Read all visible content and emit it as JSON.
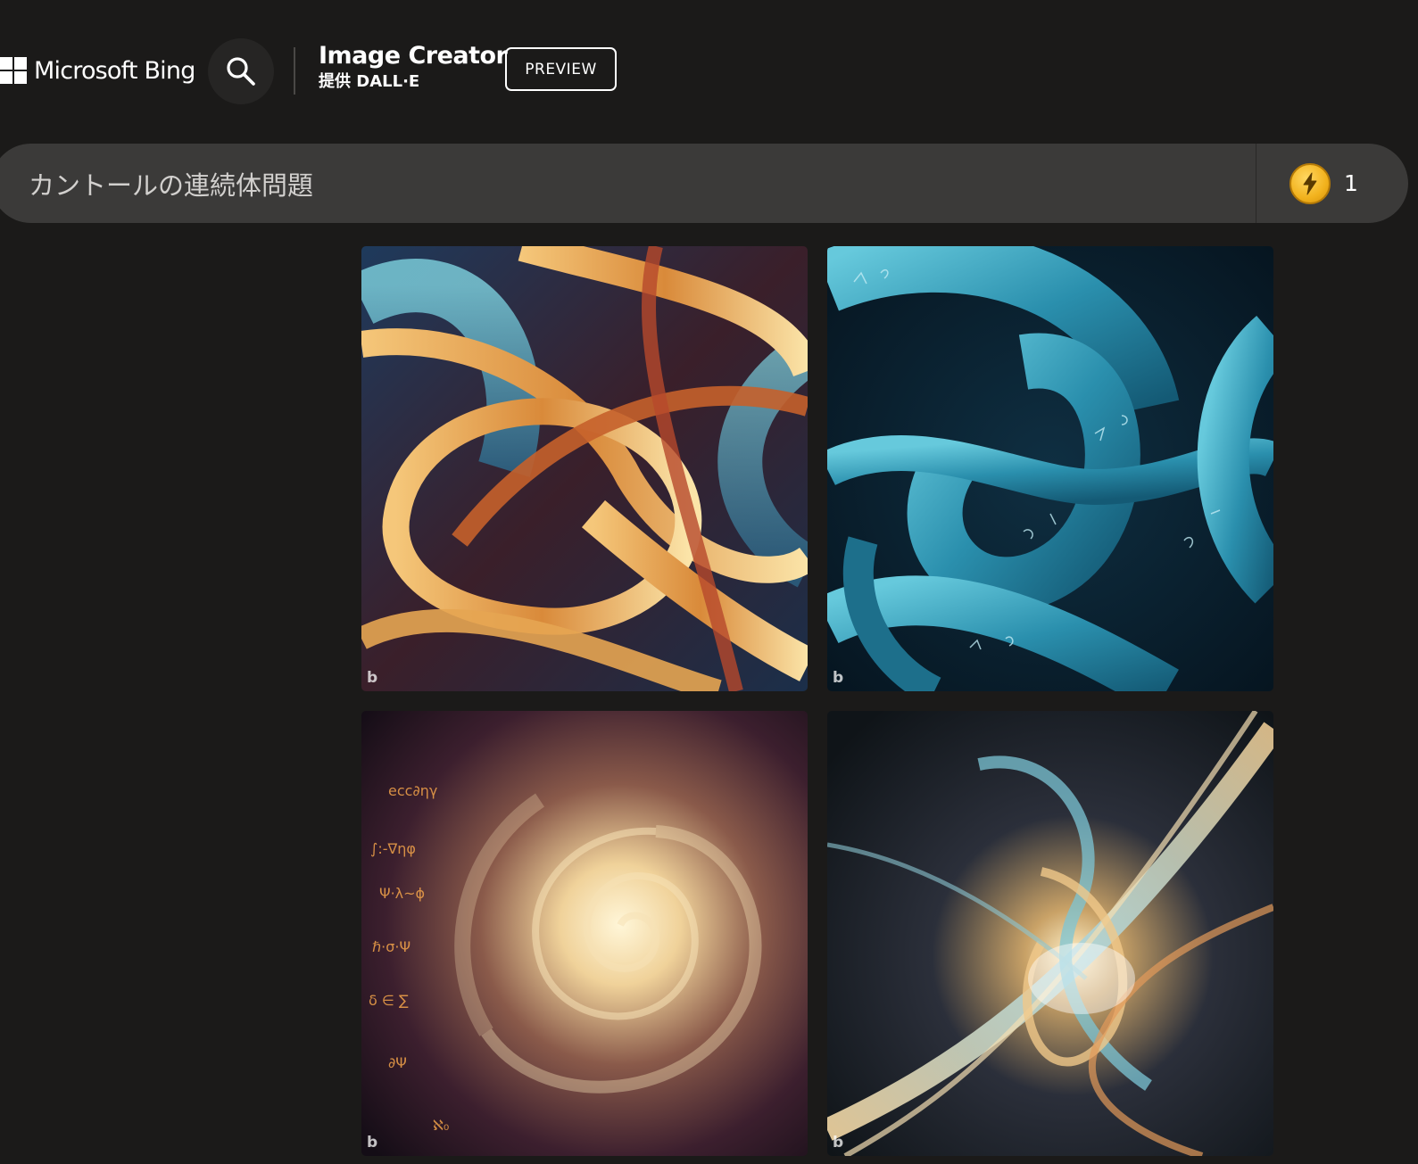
{
  "header": {
    "logo_text": "Microsoft Bing",
    "logo_icon": "microsoft-windows-logo-icon",
    "search_icon": "search-icon",
    "app_title": "Image Creator",
    "app_subtitle": "提供 DALL·E",
    "preview_label": "PREVIEW"
  },
  "prompt": {
    "value": "カントールの連続体問題",
    "placeholder": "",
    "boost_icon": "lightning-bolt-icon",
    "boosts_remaining": "1"
  },
  "images": [
    {
      "watermark": "b",
      "description_icon": "generated-image"
    },
    {
      "watermark": "b",
      "description_icon": "generated-image"
    },
    {
      "watermark": "b",
      "description_icon": "generated-image"
    },
    {
      "watermark": "b",
      "description_icon": "generated-image"
    }
  ],
  "colors": {
    "background": "#1b1a19",
    "prompt_bar": "#3b3a39",
    "boost_coin": "#f2b21d"
  }
}
